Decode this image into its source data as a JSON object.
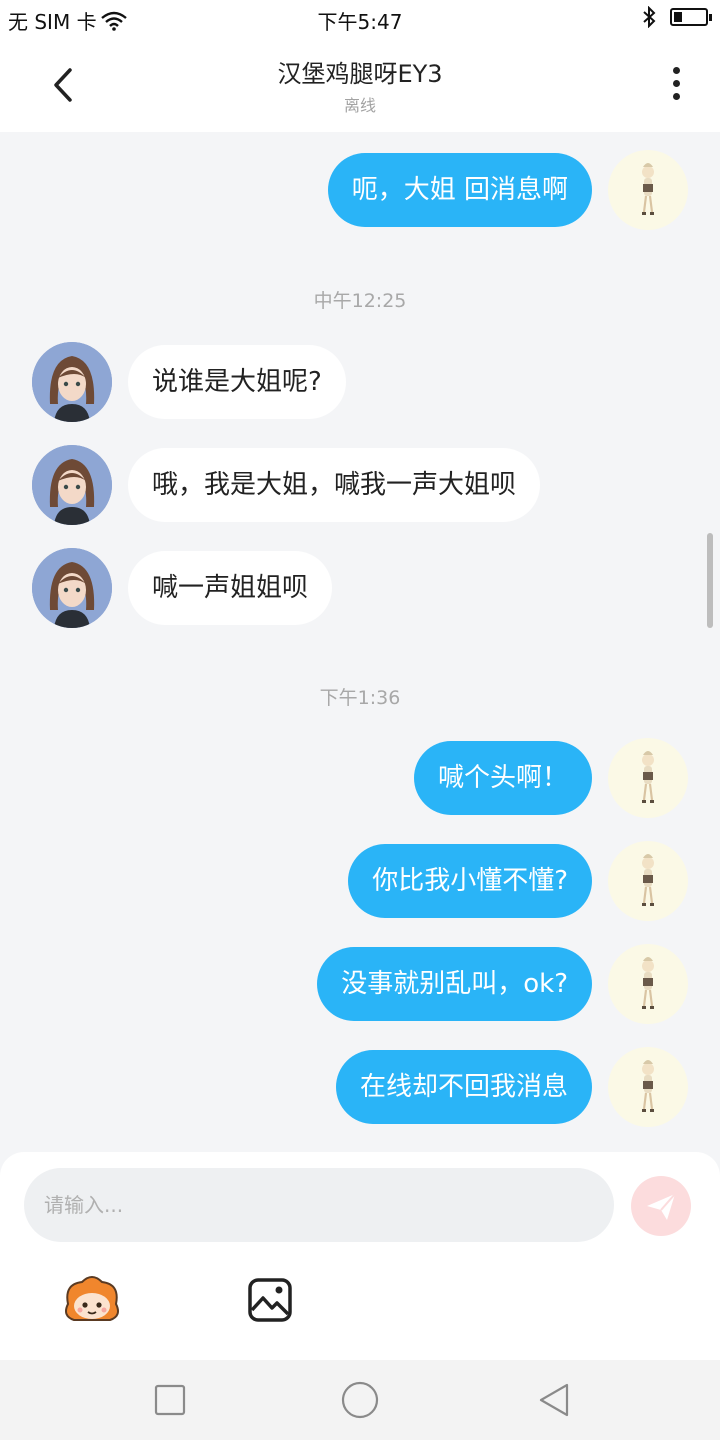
{
  "status_bar": {
    "carrier": "无 SIM 卡",
    "time": "下午5:47",
    "battery_level": 0.25
  },
  "header": {
    "title": "汉堡鸡腿呀EY3",
    "subtitle": "离线"
  },
  "messages": [
    {
      "kind": "message",
      "sender": "me",
      "text": "呃，大姐 回消息啊"
    },
    {
      "kind": "time",
      "text": "中午12:25"
    },
    {
      "kind": "message",
      "sender": "other",
      "text": "说谁是大姐呢?"
    },
    {
      "kind": "message",
      "sender": "other",
      "text": "哦，我是大姐，喊我一声大姐呗"
    },
    {
      "kind": "message",
      "sender": "other",
      "text": "喊一声姐姐呗"
    },
    {
      "kind": "time",
      "text": "下午1:36"
    },
    {
      "kind": "message",
      "sender": "me",
      "text": "喊个头啊！"
    },
    {
      "kind": "message",
      "sender": "me",
      "text": "你比我小懂不懂?"
    },
    {
      "kind": "message",
      "sender": "me",
      "text": "没事就别乱叫，ok?"
    },
    {
      "kind": "message",
      "sender": "me",
      "text": "在线却不回我消息"
    }
  ],
  "composer": {
    "placeholder": "请输入..."
  },
  "icons": {
    "back": "chevron-left-icon",
    "more": "more-vertical-icon",
    "wifi": "wifi-icon",
    "bluetooth": "bluetooth-icon",
    "battery": "battery-icon",
    "send": "send-icon",
    "emoji": "mascot-emoji-icon",
    "image": "image-icon",
    "nav_recent": "square-icon",
    "nav_home": "circle-icon",
    "nav_back": "triangle-back-icon"
  },
  "colors": {
    "my_bubble": "#2ab4f7",
    "other_bubble": "#ffffff",
    "chat_background": "#f4f5f7",
    "send_button": "#fcdcdd"
  }
}
